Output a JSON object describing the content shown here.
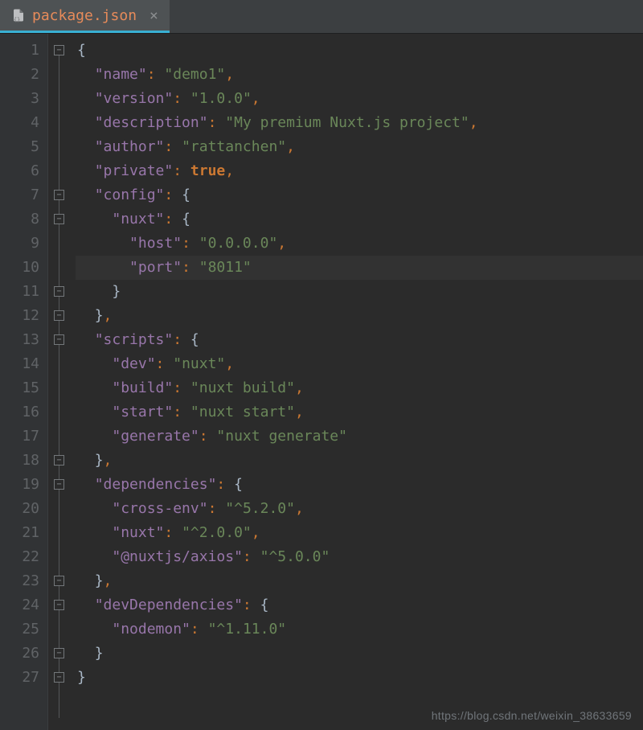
{
  "tab": {
    "filename": "package.json",
    "close_glyph": "×"
  },
  "watermark": "https://blog.csdn.net/weixin_38633659",
  "gutter": {
    "run_lines": [
      14,
      15,
      16,
      17
    ],
    "fold_open_lines": [
      1,
      27
    ],
    "fold_close_lines": [
      7,
      8,
      11,
      12,
      13,
      18,
      19,
      23,
      24,
      26
    ]
  },
  "code": {
    "lines": [
      {
        "n": 1,
        "indent": 0,
        "segs": [
          {
            "c": "br",
            "t": "{"
          }
        ]
      },
      {
        "n": 2,
        "indent": 1,
        "segs": [
          {
            "c": "k",
            "t": "\"name\""
          },
          {
            "c": "p",
            "t": ": "
          },
          {
            "c": "s",
            "t": "\"demo1\""
          },
          {
            "c": "p",
            "t": ","
          }
        ]
      },
      {
        "n": 3,
        "indent": 1,
        "segs": [
          {
            "c": "k",
            "t": "\"version\""
          },
          {
            "c": "p",
            "t": ": "
          },
          {
            "c": "s",
            "t": "\"1.0.0\""
          },
          {
            "c": "p",
            "t": ","
          }
        ]
      },
      {
        "n": 4,
        "indent": 1,
        "segs": [
          {
            "c": "k",
            "t": "\"description\""
          },
          {
            "c": "p",
            "t": ": "
          },
          {
            "c": "s",
            "t": "\"My premium Nuxt.js project\""
          },
          {
            "c": "p",
            "t": ","
          }
        ]
      },
      {
        "n": 5,
        "indent": 1,
        "segs": [
          {
            "c": "k",
            "t": "\"author\""
          },
          {
            "c": "p",
            "t": ": "
          },
          {
            "c": "s",
            "t": "\"rattanchen\""
          },
          {
            "c": "p",
            "t": ","
          }
        ]
      },
      {
        "n": 6,
        "indent": 1,
        "segs": [
          {
            "c": "k",
            "t": "\"private\""
          },
          {
            "c": "p",
            "t": ": "
          },
          {
            "c": "kw",
            "t": "true"
          },
          {
            "c": "p",
            "t": ","
          }
        ]
      },
      {
        "n": 7,
        "indent": 1,
        "segs": [
          {
            "c": "k",
            "t": "\"config\""
          },
          {
            "c": "p",
            "t": ": "
          },
          {
            "c": "br",
            "t": "{"
          }
        ]
      },
      {
        "n": 8,
        "indent": 2,
        "segs": [
          {
            "c": "k",
            "t": "\"nuxt\""
          },
          {
            "c": "p",
            "t": ": "
          },
          {
            "c": "br",
            "t": "{"
          }
        ]
      },
      {
        "n": 9,
        "indent": 3,
        "segs": [
          {
            "c": "k",
            "t": "\"host\""
          },
          {
            "c": "p",
            "t": ": "
          },
          {
            "c": "s",
            "t": "\"0.0.0.0\""
          },
          {
            "c": "p",
            "t": ","
          }
        ]
      },
      {
        "n": 10,
        "indent": 3,
        "hl": true,
        "segs": [
          {
            "c": "k",
            "t": "\"port\""
          },
          {
            "c": "p",
            "t": ": "
          },
          {
            "c": "s",
            "t": "\"8011\""
          }
        ]
      },
      {
        "n": 11,
        "indent": 2,
        "segs": [
          {
            "c": "br",
            "t": "}"
          }
        ]
      },
      {
        "n": 12,
        "indent": 1,
        "segs": [
          {
            "c": "br",
            "t": "}"
          },
          {
            "c": "p",
            "t": ","
          }
        ]
      },
      {
        "n": 13,
        "indent": 1,
        "segs": [
          {
            "c": "k",
            "t": "\"scripts\""
          },
          {
            "c": "p",
            "t": ": "
          },
          {
            "c": "br",
            "t": "{"
          }
        ]
      },
      {
        "n": 14,
        "indent": 2,
        "segs": [
          {
            "c": "k",
            "t": "\"dev\""
          },
          {
            "c": "p",
            "t": ": "
          },
          {
            "c": "s",
            "t": "\"nuxt\""
          },
          {
            "c": "p",
            "t": ","
          }
        ]
      },
      {
        "n": 15,
        "indent": 2,
        "segs": [
          {
            "c": "k",
            "t": "\"build\""
          },
          {
            "c": "p",
            "t": ": "
          },
          {
            "c": "s",
            "t": "\"nuxt build\""
          },
          {
            "c": "p",
            "t": ","
          }
        ]
      },
      {
        "n": 16,
        "indent": 2,
        "segs": [
          {
            "c": "k",
            "t": "\"start\""
          },
          {
            "c": "p",
            "t": ": "
          },
          {
            "c": "s",
            "t": "\"nuxt start\""
          },
          {
            "c": "p",
            "t": ","
          }
        ]
      },
      {
        "n": 17,
        "indent": 2,
        "segs": [
          {
            "c": "k",
            "t": "\"generate\""
          },
          {
            "c": "p",
            "t": ": "
          },
          {
            "c": "s",
            "t": "\"nuxt generate\""
          }
        ]
      },
      {
        "n": 18,
        "indent": 1,
        "segs": [
          {
            "c": "br",
            "t": "}"
          },
          {
            "c": "p",
            "t": ","
          }
        ]
      },
      {
        "n": 19,
        "indent": 1,
        "segs": [
          {
            "c": "k",
            "t": "\"dependencies\""
          },
          {
            "c": "p",
            "t": ": "
          },
          {
            "c": "br",
            "t": "{"
          }
        ]
      },
      {
        "n": 20,
        "indent": 2,
        "segs": [
          {
            "c": "k",
            "t": "\"cross-env\""
          },
          {
            "c": "p",
            "t": ": "
          },
          {
            "c": "s",
            "t": "\"^5.2.0\""
          },
          {
            "c": "p",
            "t": ","
          }
        ]
      },
      {
        "n": 21,
        "indent": 2,
        "segs": [
          {
            "c": "k",
            "t": "\"nuxt\""
          },
          {
            "c": "p",
            "t": ": "
          },
          {
            "c": "s",
            "t": "\"^2.0.0\""
          },
          {
            "c": "p",
            "t": ","
          }
        ]
      },
      {
        "n": 22,
        "indent": 2,
        "segs": [
          {
            "c": "k",
            "t": "\"@nuxtjs/axios\""
          },
          {
            "c": "p",
            "t": ": "
          },
          {
            "c": "s",
            "t": "\"^5.0.0\""
          }
        ]
      },
      {
        "n": 23,
        "indent": 1,
        "segs": [
          {
            "c": "br",
            "t": "}"
          },
          {
            "c": "p",
            "t": ","
          }
        ]
      },
      {
        "n": 24,
        "indent": 1,
        "segs": [
          {
            "c": "k",
            "t": "\"devDependencies\""
          },
          {
            "c": "p",
            "t": ": "
          },
          {
            "c": "br",
            "t": "{"
          }
        ]
      },
      {
        "n": 25,
        "indent": 2,
        "segs": [
          {
            "c": "k",
            "t": "\"nodemon\""
          },
          {
            "c": "p",
            "t": ": "
          },
          {
            "c": "s",
            "t": "\"^1.11.0\""
          }
        ]
      },
      {
        "n": 26,
        "indent": 1,
        "segs": [
          {
            "c": "br",
            "t": "}"
          }
        ]
      },
      {
        "n": 27,
        "indent": 0,
        "segs": [
          {
            "c": "br",
            "t": "}"
          }
        ]
      }
    ]
  }
}
